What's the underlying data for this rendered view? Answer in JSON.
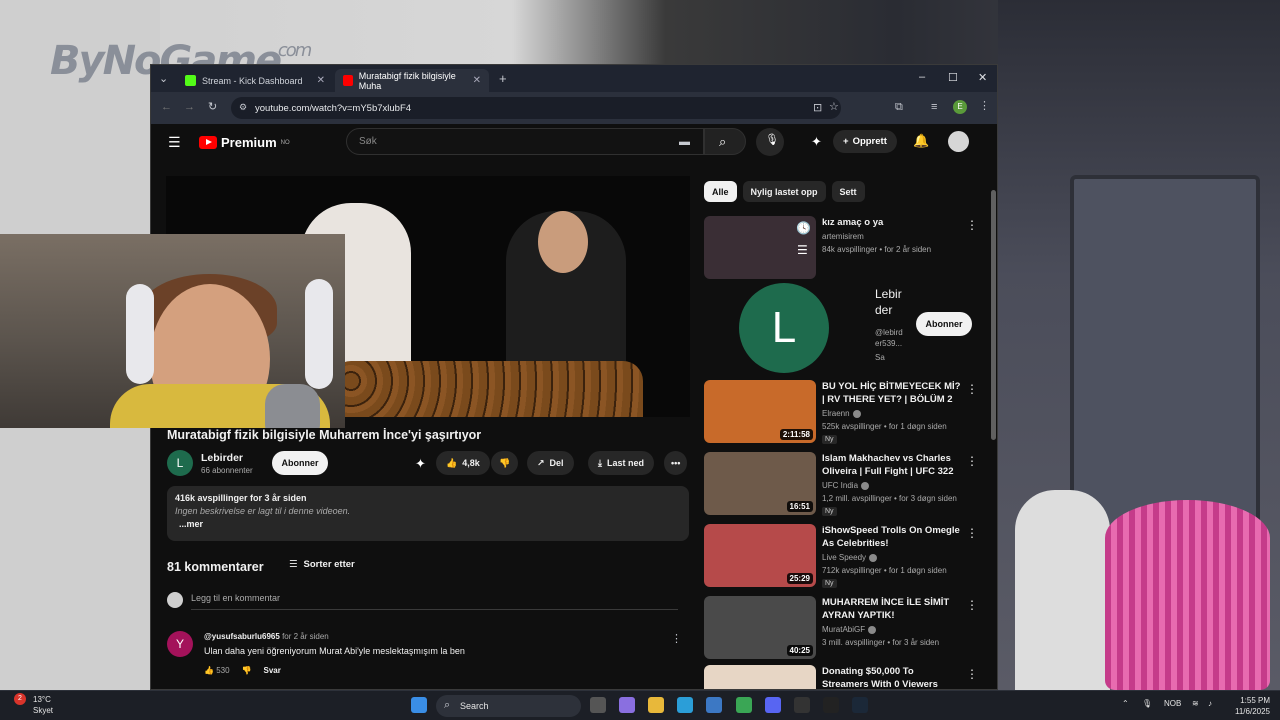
{
  "overlay_logo": {
    "text": "ByNoGame",
    "suffix": ".com"
  },
  "browser": {
    "tabs": [
      {
        "label": "Stream - Kick Dashboard",
        "icon": "kick-icon",
        "color": "#53fc18"
      },
      {
        "label": "Muratabigf fizik bilgisiyle Muha",
        "icon": "youtube-icon",
        "color": "#ff0000"
      }
    ],
    "url": "youtube.com/watch?v=mY5b7xlubF4",
    "profile_initial": "E"
  },
  "youtube": {
    "logo_text": "Premium",
    "logo_region": "NO",
    "search_placeholder": "Søk",
    "create_label": "Opprett",
    "video": {
      "title": "Muratabigf fizik bilgisiyle Muharrem İnce'yi şaşırtıyor",
      "channel_initial": "L",
      "channel_name": "Lebirder",
      "subscribers": "66 abonnenter",
      "subscribe_label": "Abonner",
      "likes": "4,8k",
      "share_label": "Del",
      "download_label": "Last ned"
    },
    "description": {
      "stats": "416k avspillinger  for 3 år siden",
      "text": "Ingen beskrivelse er lagt til i denne videoen.",
      "more": "...mer"
    },
    "comments": {
      "count": "81 kommentarer",
      "sort_label": "Sorter etter",
      "add_placeholder": "Legg til en kommentar",
      "items": [
        {
          "initial": "Y",
          "user": "@yusufsaburlu6965",
          "time": "for 2 år siden",
          "text": "Ulan daha yeni öğreniyorum Murat Abi'yle meslektaşmışım la ben",
          "likes": "530",
          "reply": "Svar"
        }
      ]
    },
    "chips": [
      "Alle",
      "Nylig lastet opp",
      "Sett"
    ],
    "channel_card": {
      "initial": "L",
      "name_line1": "Lebir",
      "name_line2": "der",
      "handle_line1": "@lebird",
      "handle_line2": "er539...",
      "extra": "Sa",
      "subscribe_label": "Abonner"
    },
    "recommendations": [
      {
        "title": "kız amaç o ya",
        "channel": "artemisirem",
        "meta": "84k avspillinger • for 2 år siden",
        "duration": "",
        "badge": "",
        "verified": false,
        "thumb_color": "#3a2e35"
      },
      {
        "title": "BU YOL HİÇ BİTMEYECEK Mİ? | RV THERE YET? | BÖLÜM 2",
        "channel": "Elraenn",
        "meta": "525k avspillinger • for 1 døgn siden",
        "duration": "2:11:58",
        "badge": "Ny",
        "verified": true,
        "thumb_color": "#c86a2a"
      },
      {
        "title": "Islam Makhachev vs Charles Oliveira | Full Fight | UFC 322",
        "channel": "UFC India",
        "meta": "1,2 mill. avspillinger • for 3 døgn siden",
        "duration": "16:51",
        "badge": "Ny",
        "verified": true,
        "thumb_color": "#6e5a4a"
      },
      {
        "title": "iShowSpeed Trolls On Omegle As Celebrities!",
        "channel": "Live Speedy",
        "meta": "712k avspillinger • for 1 døgn siden",
        "duration": "25:29",
        "badge": "Ny",
        "verified": true,
        "thumb_color": "#b64a4a"
      },
      {
        "title": "MUHARREM İNCE İLE SİMİT AYRAN YAPTIK!",
        "channel": "MuratAbiGF",
        "meta": "3 mill. avspillinger • for 3 år siden",
        "duration": "40:25",
        "badge": "",
        "verified": true,
        "thumb_color": "#4a4a4a"
      },
      {
        "title": "Donating $50,000 To Streamers With 0 Viewers",
        "channel": "",
        "meta": "",
        "duration": "",
        "badge": "",
        "verified": false,
        "thumb_color": "#e7d6c5"
      }
    ]
  },
  "taskbar": {
    "weather_temp": "13°C",
    "weather_desc": "Skyet",
    "weather_badge": "2",
    "search_placeholder": "Search",
    "lang": "NOB",
    "time": "1:55 PM",
    "date": "11/6/2025"
  }
}
